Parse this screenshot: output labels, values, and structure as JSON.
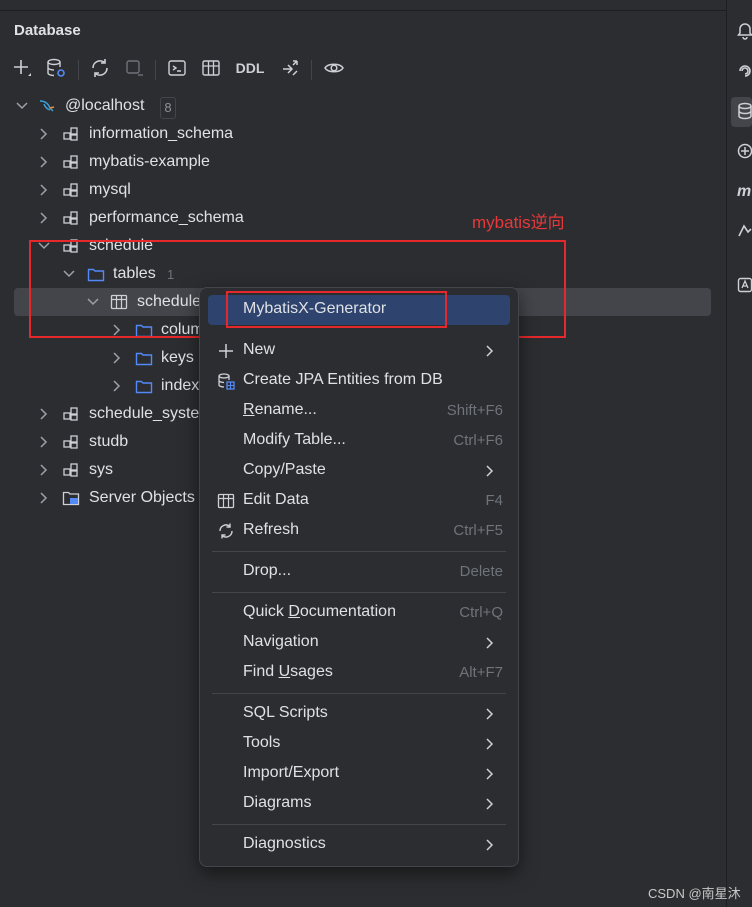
{
  "panel": {
    "title": "Database"
  },
  "toolbar": {
    "ddl_label": "DDL"
  },
  "tree": {
    "connection": {
      "label": "@localhost",
      "count": "8"
    },
    "items": [
      {
        "label": "information_schema"
      },
      {
        "label": "mybatis-example"
      },
      {
        "label": "mysql"
      },
      {
        "label": "performance_schema"
      },
      {
        "label": "schedule"
      },
      {
        "label": "tables",
        "count": "1"
      },
      {
        "label": "schedule"
      },
      {
        "label": "colum"
      },
      {
        "label": "keys"
      },
      {
        "label": "index"
      },
      {
        "label": "schedule_syste"
      },
      {
        "label": "studb"
      },
      {
        "label": "sys"
      },
      {
        "label": "Server Objects"
      }
    ]
  },
  "annotation": {
    "text": "mybatis逆向",
    "color": "#e5282b"
  },
  "context_menu": {
    "items": [
      {
        "label": "MybatisX-Generator",
        "highlighted": true
      },
      {
        "label": "New",
        "submenu": true
      },
      {
        "label": "Create JPA Entities from DB"
      },
      {
        "label": "Rename...",
        "shortcut": "Shift+F6"
      },
      {
        "label": "Modify Table...",
        "shortcut": "Ctrl+F6"
      },
      {
        "label": "Copy/Paste",
        "submenu": true
      },
      {
        "label": "Edit Data",
        "shortcut": "F4"
      },
      {
        "label": "Refresh",
        "shortcut": "Ctrl+F5"
      },
      {
        "label": "Drop...",
        "shortcut": "Delete"
      },
      {
        "label": "Quick Documentation",
        "shortcut": "Ctrl+Q"
      },
      {
        "label": "Navigation",
        "submenu": true
      },
      {
        "label": "Find Usages",
        "shortcut": "Alt+F7"
      },
      {
        "label": "SQL Scripts",
        "submenu": true
      },
      {
        "label": "Tools",
        "submenu": true
      },
      {
        "label": "Import/Export",
        "submenu": true
      },
      {
        "label": "Diagrams",
        "submenu": true
      },
      {
        "label": "Diagnostics",
        "submenu": true
      }
    ]
  },
  "watermark": "CSDN @南星沐",
  "colors": {
    "background": "#2b2d30",
    "selection": "#43454a",
    "menu_highlight": "#2e436e",
    "folder_icon": "#548af7",
    "annotation": "#e5282b"
  }
}
